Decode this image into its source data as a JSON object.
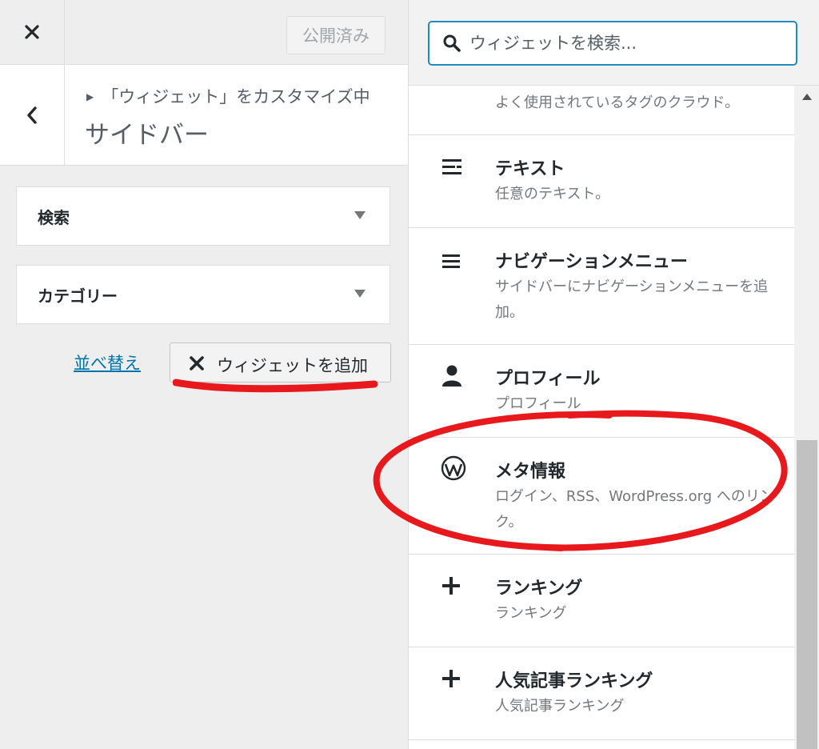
{
  "topbar": {
    "publish_label": "公開済み"
  },
  "header": {
    "breadcrumb": "「ウィジェット」をカスタマイズ中",
    "title": "サイドバー"
  },
  "widgets": [
    {
      "label": "検索"
    },
    {
      "label": "カテゴリー"
    }
  ],
  "actions": {
    "reorder_label": "並べ替え",
    "add_widget_label": "ウィジェットを追加"
  },
  "search": {
    "placeholder": "ウィジェットを検索..."
  },
  "available_widgets": [
    {
      "title": "",
      "desc": "よく使用されているタグのクラウド。",
      "icon": "tag-cloud-icon"
    },
    {
      "title": "テキスト",
      "desc": "任意のテキスト。",
      "icon": "text-icon"
    },
    {
      "title": "ナビゲーションメニュー",
      "desc": "サイドバーにナビゲーションメニューを追加。",
      "icon": "menu-icon"
    },
    {
      "title": "プロフィール",
      "desc": "プロフィール",
      "icon": "person-icon"
    },
    {
      "title": "メタ情報",
      "desc": "ログイン、RSS、WordPress.org へのリンク。",
      "icon": "wordpress-icon"
    },
    {
      "title": "ランキング",
      "desc": "ランキング",
      "icon": "plus-icon"
    },
    {
      "title": "人気記事ランキング",
      "desc": "人気記事ランキング",
      "icon": "plus-icon"
    }
  ],
  "colors": {
    "accent": "#1e8cbe",
    "link": "#0073aa",
    "annotation": "#e8191c"
  }
}
